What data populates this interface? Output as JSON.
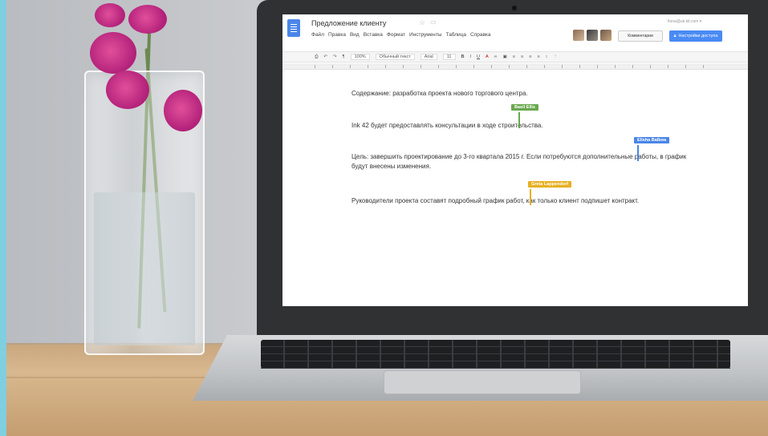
{
  "document": {
    "title": "Предложение клиенту",
    "menu": [
      "Файл",
      "Правка",
      "Вид",
      "Вставка",
      "Формат",
      "Инструменты",
      "Таблица",
      "Справка"
    ],
    "user_email": "fiona@uk.kit.com ▾",
    "comments_label": "Комментарии",
    "share_label": "Настройки доступа",
    "toolbar": {
      "zoom": "100%",
      "style": "Обычный текст",
      "font": "Arial",
      "size": "11"
    },
    "paragraphs": [
      "Содержание: разработка проекта нового торгового центра.",
      "Ink 42 будет предоставлять консультации в ходе строительства.",
      "Цель: завершить проектирование до 3-го квартала 2015 г. Если потребуются дополнительные работы, в график будут внесены изменения.",
      "Руководители проекта составят подробный график работ, как только клиент подпишет контракт."
    ],
    "collaborators": [
      {
        "name": "Basil Ellis",
        "color": "#6aa84f"
      },
      {
        "name": "Elisha Balboa",
        "color": "#4a86e8"
      },
      {
        "name": "Greta Lappendorf",
        "color": "#e6b021"
      }
    ]
  },
  "colors": {
    "brand": "#4a86e8",
    "share_button": "#4a8af4",
    "orchid": "#c7287f"
  }
}
